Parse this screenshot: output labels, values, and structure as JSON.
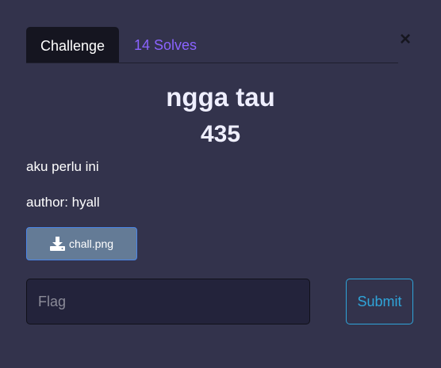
{
  "tabs": {
    "challenge_label": "Challenge",
    "solves_label": "14 Solves"
  },
  "close": {
    "glyph": "×",
    "icon": "close-icon"
  },
  "challenge": {
    "name": "ngga tau",
    "value": "435",
    "description": "aku perlu ini",
    "author": "author: hyall"
  },
  "file": {
    "label": "chall.png",
    "icon": "download-icon"
  },
  "form": {
    "flag_placeholder": "Flag",
    "flag_value": "",
    "submit_label": "Submit"
  },
  "colors": {
    "background": "#33334c",
    "active_tab": "#151520",
    "solves_link": "#8a63ff",
    "submit_accent": "#2fa4d9",
    "file_button": "#647b96"
  }
}
